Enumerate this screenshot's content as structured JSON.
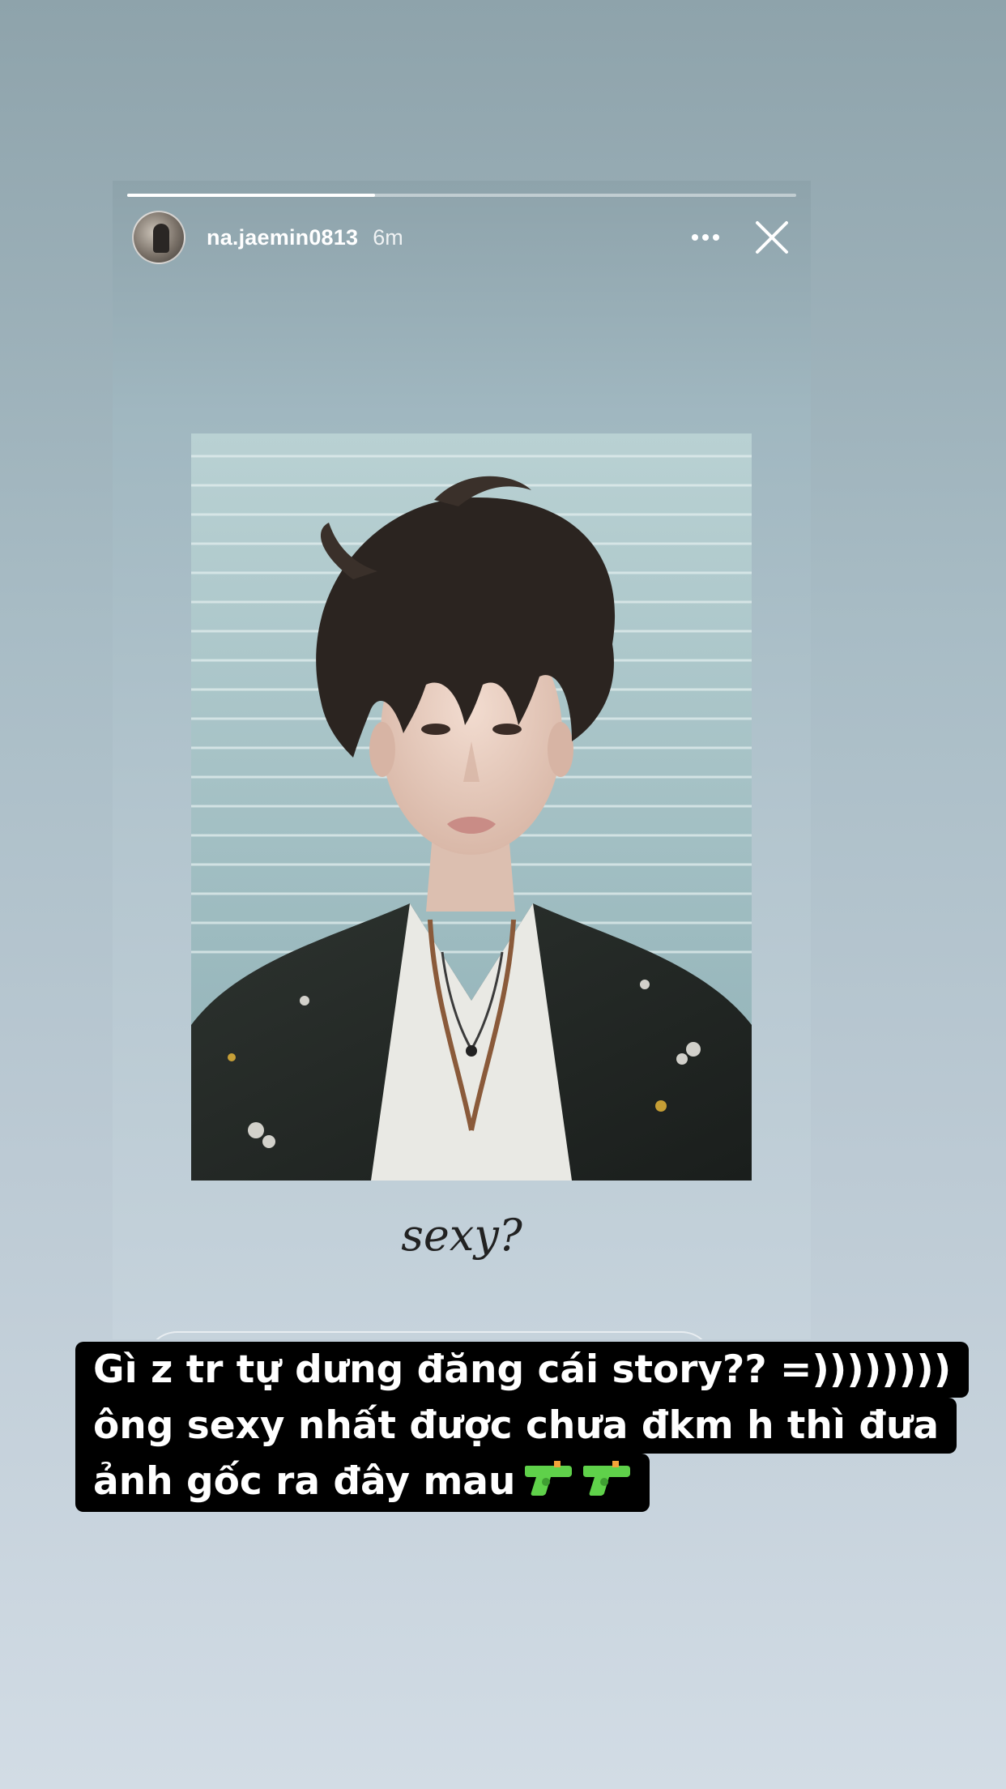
{
  "story": {
    "username": "na.jaemin0813",
    "timestamp": "6m",
    "progress": 0.37,
    "caption": "sexy?"
  },
  "overlay": {
    "line1": "Gì z tr tự dưng đăng cái story?? =))))))))",
    "line2": "ông sexy nhất được chưa đkm h thì đưa",
    "line3": "ảnh gốc ra đây mau"
  },
  "icons": {
    "more": "more-horizontal-icon",
    "close": "close-icon",
    "emoji": "water-pistol-emoji"
  },
  "colors": {
    "highlight": "#000000",
    "overlay_text": "#ffffff",
    "pistol": "#5fd14a"
  }
}
